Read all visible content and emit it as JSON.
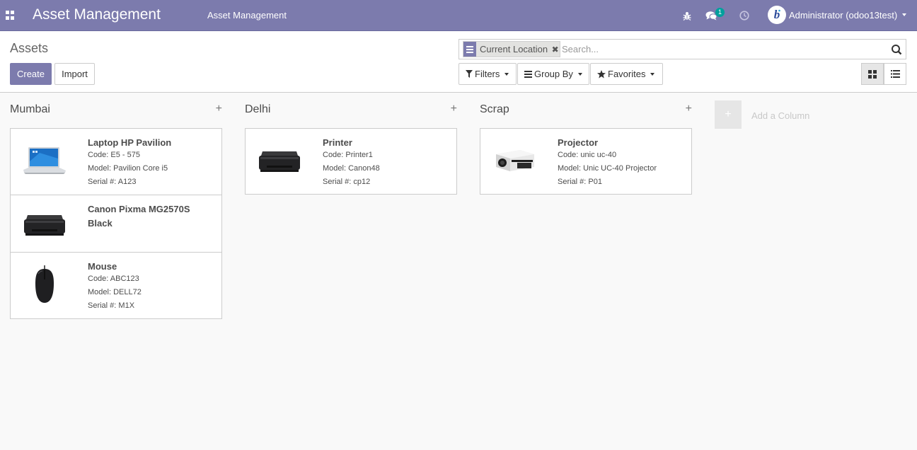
{
  "navbar": {
    "app_title": "Asset Management",
    "menu_item": "Asset Management",
    "message_count": "1",
    "user_name": "Administrator (odoo13test)",
    "bg_color": "#7c7bad"
  },
  "control_panel": {
    "breadcrumb": "Assets",
    "create_label": "Create",
    "import_label": "Import",
    "search": {
      "facet_label": "Current Location",
      "placeholder": "Search..."
    },
    "filters_label": "Filters",
    "group_by_label": "Group By",
    "favorites_label": "Favorites"
  },
  "kanban": {
    "columns": [
      {
        "title": "Mumbai",
        "cards": [
          {
            "name": "Laptop HP Pavilion",
            "code": "Code: E5 - 575",
            "model": "Model: Pavilion Core i5",
            "serial": "Serial #: A123",
            "image": "laptop"
          },
          {
            "name": "Canon Pixma MG2570S Black",
            "code": "",
            "model": "",
            "serial": "",
            "image": "printer"
          },
          {
            "name": "Mouse",
            "code": "Code: ABC123",
            "model": "Model: DELL72",
            "serial": "Serial #: M1X",
            "image": "mouse"
          }
        ]
      },
      {
        "title": "Delhi",
        "cards": [
          {
            "name": "Printer",
            "code": "Code: Printer1",
            "model": "Model: Canon48",
            "serial": "Serial #: cp12",
            "image": "printer"
          }
        ]
      },
      {
        "title": "Scrap",
        "cards": [
          {
            "name": "Projector",
            "code": "Code: unic uc-40",
            "model": "Model: Unic UC-40 Projector",
            "serial": "Serial #: P01",
            "image": "projector"
          }
        ]
      }
    ],
    "add_column_label": "Add a Column"
  }
}
